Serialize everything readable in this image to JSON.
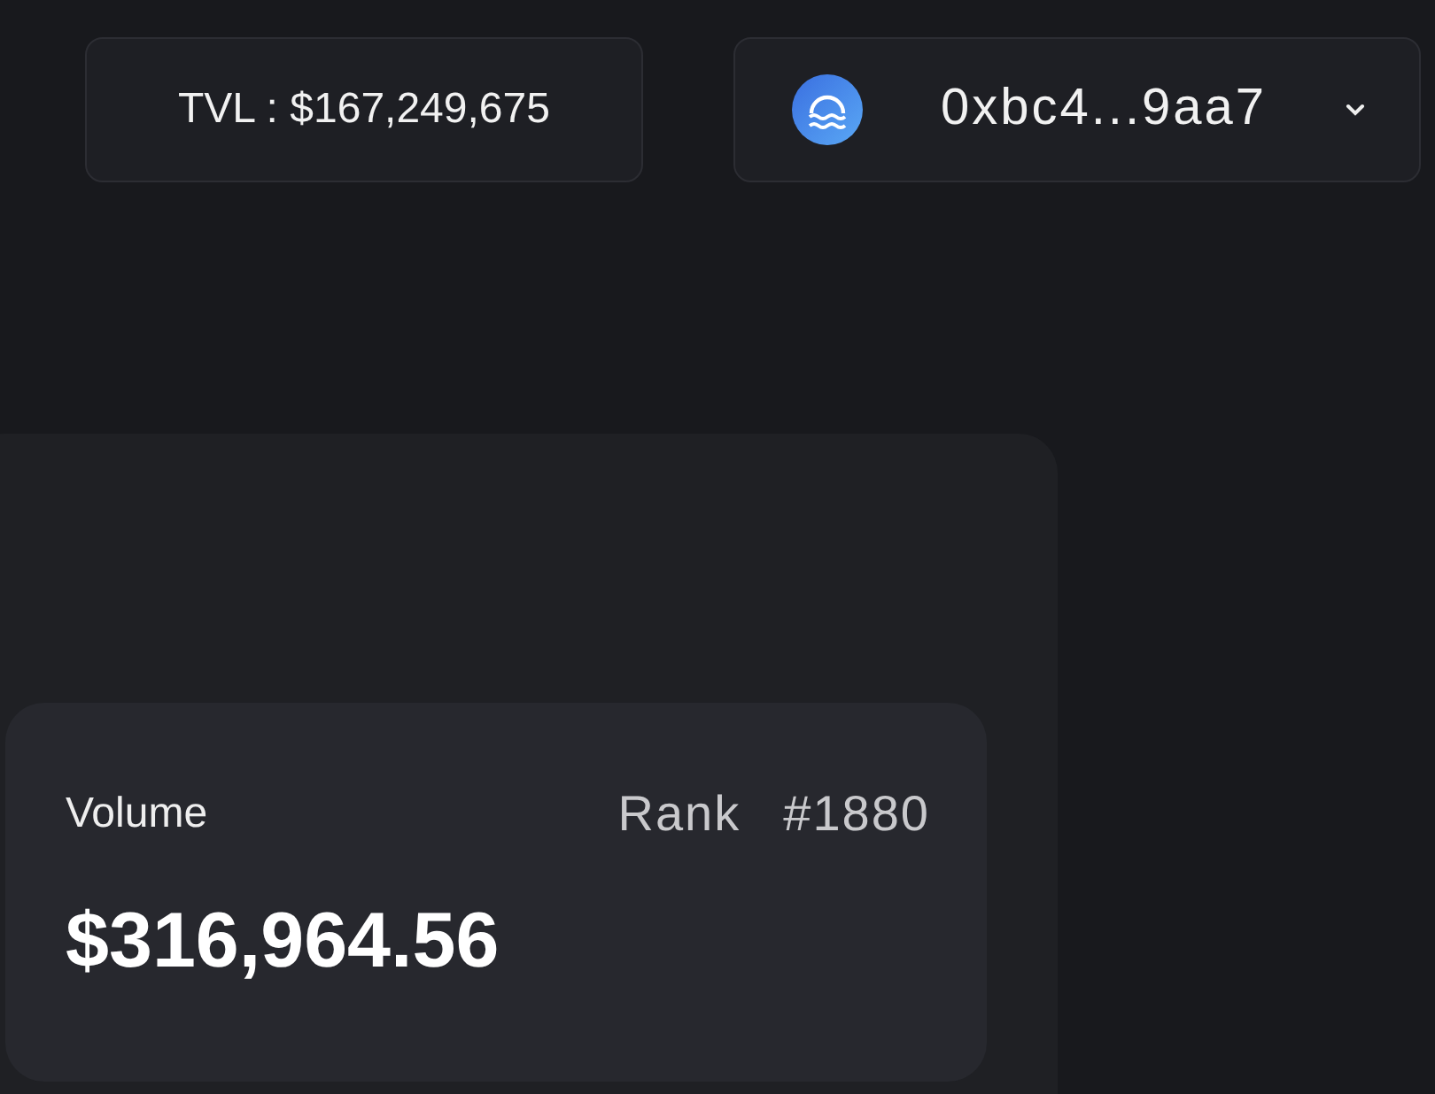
{
  "header": {
    "tvl": "TVL : $167,249,675",
    "wallet": {
      "address": "0xbc4...9aa7",
      "expanded": false
    }
  },
  "stats_card": {
    "label": "Volume",
    "rank_label": "Rank",
    "rank": "#1880",
    "value": "$316,964.56"
  }
}
